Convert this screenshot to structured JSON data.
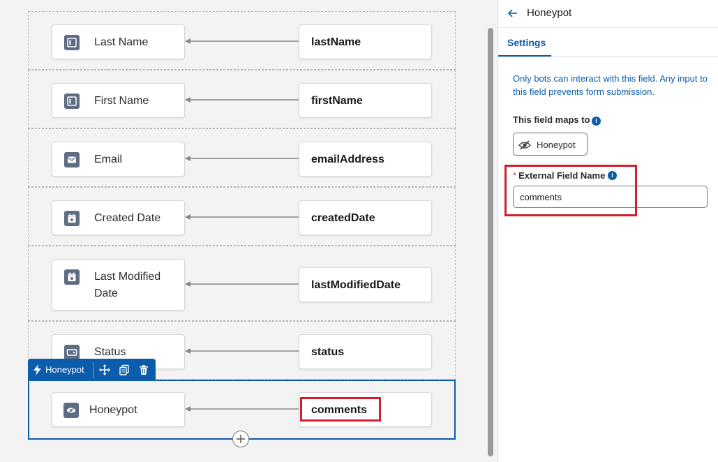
{
  "rows": [
    {
      "field_label": "Last Name",
      "field_icon": "text-field-icon",
      "mapped_name": "lastName"
    },
    {
      "field_label": "First Name",
      "field_icon": "text-field-icon",
      "mapped_name": "firstName"
    },
    {
      "field_label": "Email",
      "field_icon": "email-icon",
      "mapped_name": "emailAddress"
    },
    {
      "field_label": "Created Date",
      "field_icon": "calendar-icon",
      "mapped_name": "createdDate"
    },
    {
      "field_label": "Last Modified Date",
      "field_icon": "calendar-icon",
      "mapped_name": "lastModifiedDate"
    },
    {
      "field_label": "Status",
      "field_icon": "picklist-icon",
      "mapped_name": "status"
    }
  ],
  "selected_row": {
    "field_label": "Honeypot",
    "field_icon": "hidden-eye-icon",
    "mapped_name": "comments"
  },
  "toolbar": {
    "label": "Honeypot",
    "icon": "lightning-bolt-icon",
    "move_icon": "move-icon",
    "copy_icon": "copy-icon",
    "delete_icon": "trash-icon"
  },
  "panel": {
    "title": "Honeypot",
    "tab": "Settings",
    "description": "Only bots can interact with this field. Any input to this field prevents form submission.",
    "maps_to_label": "This field maps to",
    "maps_to_value": "Honeypot",
    "required_marker": "*",
    "external_field_label": "External Field Name",
    "external_field_value": "comments"
  },
  "colors": {
    "brand": "#0b5cab",
    "highlight": "#d0202d",
    "icon_bg": "#5f6d82"
  }
}
